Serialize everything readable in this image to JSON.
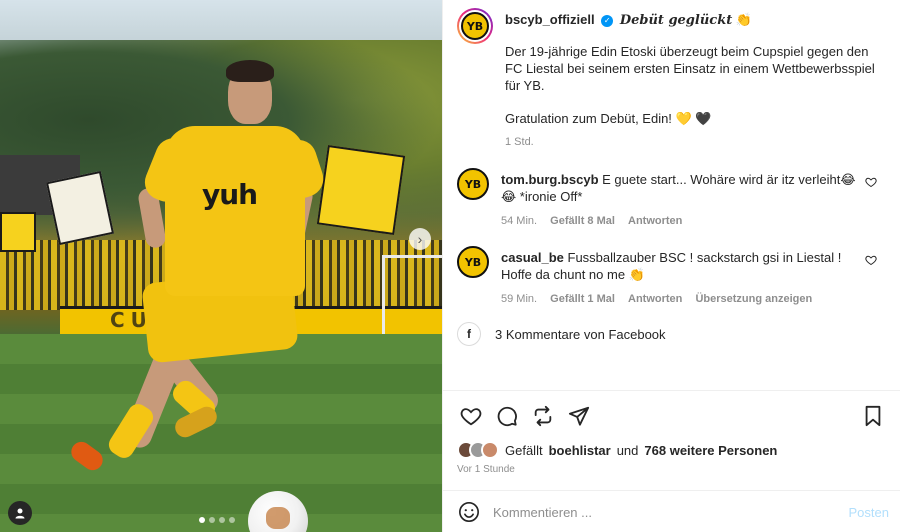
{
  "post": {
    "account": "bscyb_offiziell",
    "verified_mark": "✓",
    "logo_text": "YB",
    "title": "Debüt geglückt",
    "title_emoji": "👏",
    "paragraph1": "Der 19-jährige Edin Etoski überzeugt beim Cupspiel gegen den FC Liestal bei seinem ersten Einsatz in einem Wettbewerbsspiel für YB.",
    "paragraph2": "Gratulation zum Debüt, Edin! 💛 🖤",
    "caption_time": "1 Std.",
    "banner_text": "CUP KURV"
  },
  "comments": [
    {
      "user": "tom.burg.bscyb",
      "text": "E guete start... Wohäre wird är itz verleiht😂 😂 *ironie Off*",
      "time": "54 Min.",
      "likes": "Gefällt 8 Mal",
      "reply": "Antworten",
      "translate": ""
    },
    {
      "user": "casual_be",
      "text": "Fussballzauber BSC ! sackstarch gsi in Liestal ! Hoffe da chunt no me 👏",
      "time": "59 Min.",
      "likes": "Gefällt 1 Mal",
      "reply": "Antworten",
      "translate": "Übersetzung anzeigen"
    }
  ],
  "facebook": {
    "icon_glyph": "f",
    "label": "3 Kommentare von Facebook"
  },
  "likes": {
    "prefix": "Gefällt",
    "user": "boehlistar",
    "middle": "und",
    "others": "768 weitere Personen",
    "time_ago": "Vor 1 Stunde"
  },
  "comment_box": {
    "placeholder": "Kommentieren ...",
    "post_label": "Posten"
  },
  "carousel": {
    "slide_count": 4,
    "active_index": 0,
    "next_glyph": "›"
  },
  "colors": {
    "accent": "#0095f6",
    "yb_yellow": "#f2c300",
    "post_disabled": "#b2dffc"
  }
}
